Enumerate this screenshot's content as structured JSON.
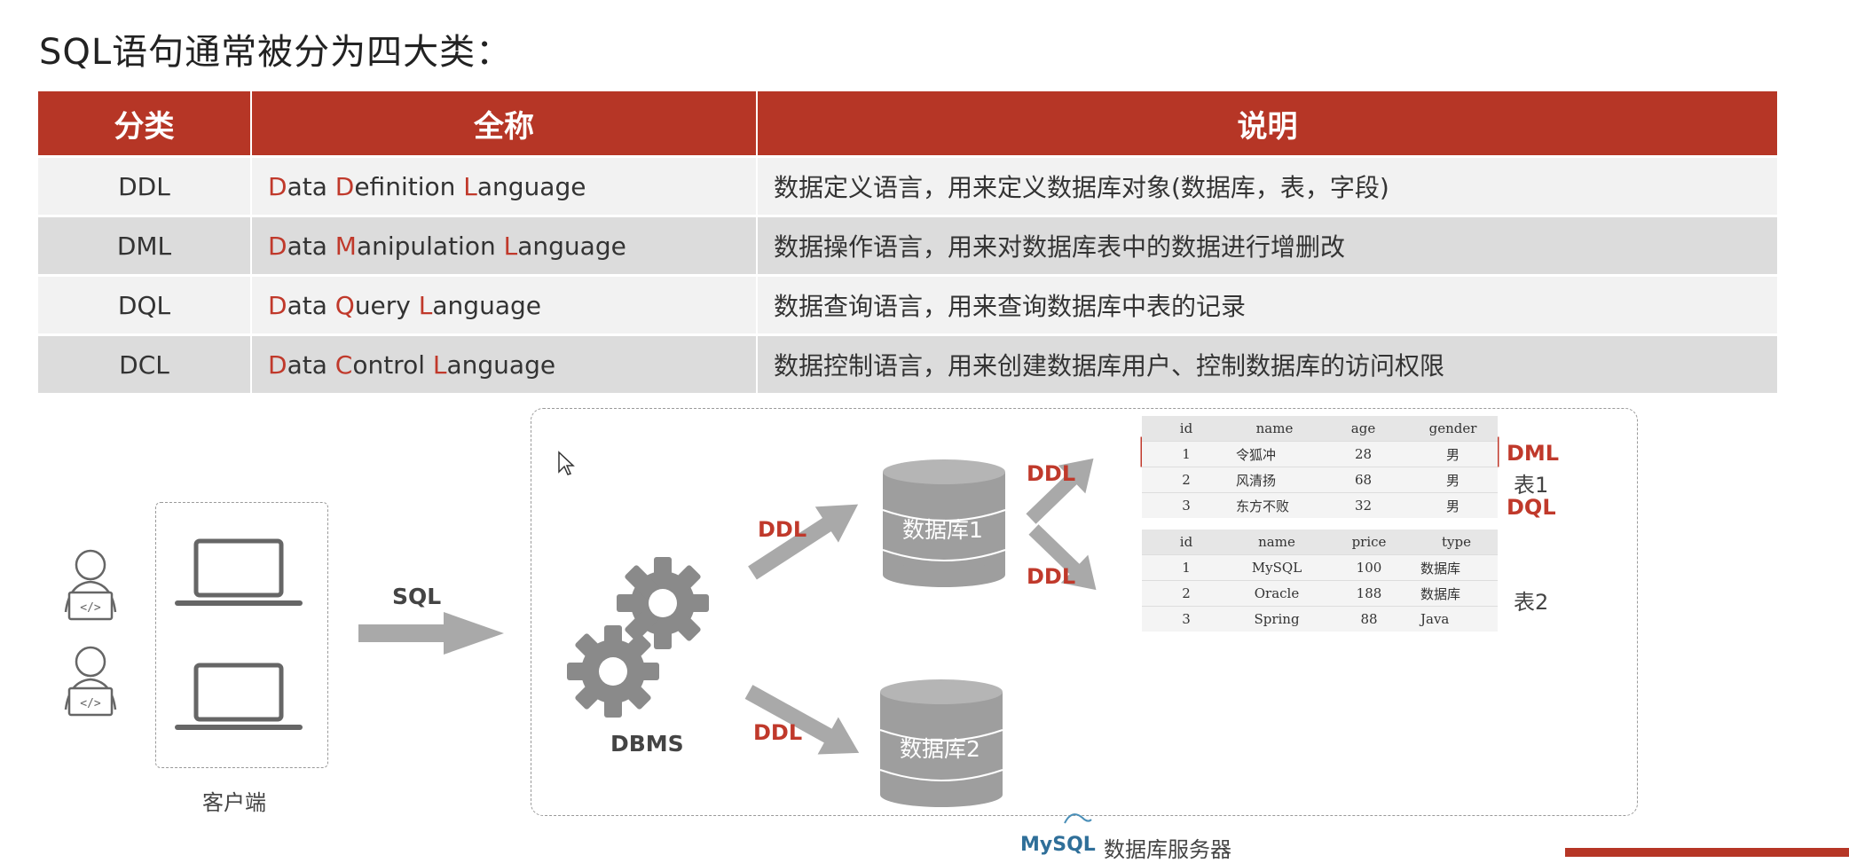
{
  "title": "SQL语句通常被分为四大类：",
  "table": {
    "headers": [
      "分类",
      "全称",
      "说明"
    ],
    "rows": [
      {
        "category": "DDL",
        "name_parts": [
          "D",
          "ata ",
          "D",
          "efinition ",
          "L",
          "anguage"
        ],
        "desc": "数据定义语言，用来定义数据库对象(数据库，表，字段)"
      },
      {
        "category": "DML",
        "name_parts": [
          "D",
          "ata ",
          "M",
          "anipulation ",
          "L",
          "anguage"
        ],
        "desc": "数据操作语言，用来对数据库表中的数据进行增删改"
      },
      {
        "category": "DQL",
        "name_parts": [
          "D",
          "ata ",
          "Q",
          "uery ",
          "L",
          "anguage"
        ],
        "desc": "数据查询语言，用来查询数据库中表的记录"
      },
      {
        "category": "DCL",
        "name_parts": [
          "D",
          "ata ",
          "C",
          "ontrol ",
          "L",
          "anguage"
        ],
        "desc": "数据控制语言，用来创建数据库用户、控制数据库的访问权限"
      }
    ]
  },
  "diagram": {
    "client_label": "客户端",
    "sql_label": "SQL",
    "dbms_label": "DBMS",
    "ddl_label": "DDL",
    "db1_label": "数据库1",
    "db2_label": "数据库2",
    "dml_label": "DML",
    "dql_label": "DQL",
    "table1_label": "表1",
    "table2_label": "表2",
    "server_logo": "MySQL",
    "server_label": "数据库服务器",
    "table1": {
      "headers": [
        "id",
        "name",
        "age",
        "gender"
      ],
      "rows": [
        [
          "1",
          "令狐冲",
          "28",
          "男"
        ],
        [
          "2",
          "风清扬",
          "68",
          "男"
        ],
        [
          "3",
          "东方不败",
          "32",
          "男"
        ]
      ]
    },
    "table2": {
      "headers": [
        "id",
        "name",
        "price",
        "type"
      ],
      "rows": [
        [
          "1",
          "MySQL",
          "100",
          "数据库"
        ],
        [
          "2",
          "Oracle",
          "188",
          "数据库"
        ],
        [
          "3",
          "Spring",
          "88",
          "Java"
        ]
      ]
    }
  },
  "colors": {
    "accent": "#b63626",
    "highlight": "#c0392b",
    "arrow": "#a9a9a9",
    "db": "#9e9e9e"
  }
}
